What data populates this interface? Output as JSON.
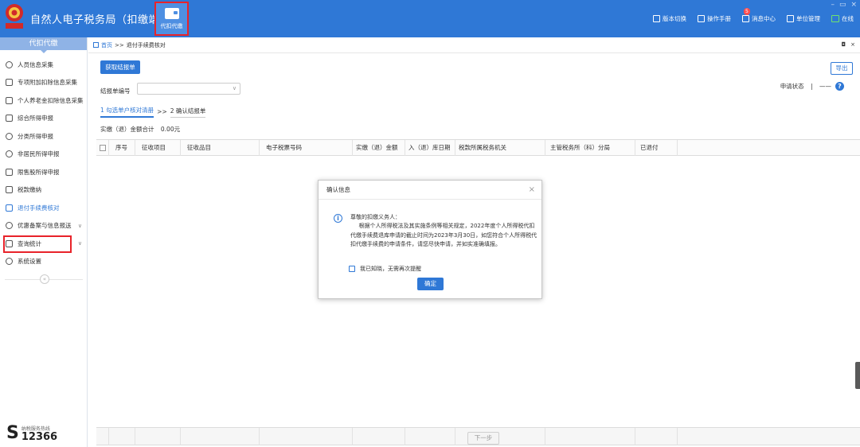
{
  "app": {
    "title": "自然人电子税务局（扣缴端）",
    "module_label": "代扣代缴",
    "window_controls": [
      "–",
      "▭",
      "×"
    ]
  },
  "top_actions": [
    {
      "label": "版本切换",
      "icon": "switch-icon"
    },
    {
      "label": "操作手册",
      "icon": "manual-icon"
    },
    {
      "label": "消息中心",
      "icon": "message-icon",
      "badge": "5"
    },
    {
      "label": "单位管理",
      "icon": "unit-icon"
    },
    {
      "label": "在线",
      "icon": "online-icon"
    }
  ],
  "sidebar": {
    "header": "代扣代缴",
    "items": [
      {
        "label": "人员信息采集",
        "icon": "person-icon"
      },
      {
        "label": "专项附加扣除信息采集",
        "icon": "list-icon"
      },
      {
        "label": "个人养老金扣除信息采集",
        "icon": "document-icon"
      },
      {
        "label": "综合所得申报",
        "icon": "layers-icon"
      },
      {
        "label": "分类所得申报",
        "icon": "pie-icon"
      },
      {
        "label": "非居民所得申报",
        "icon": "foreign-person-icon"
      },
      {
        "label": "限售股所得申报",
        "icon": "bar-chart-icon"
      },
      {
        "label": "税款缴纳",
        "icon": "wallet-icon"
      },
      {
        "label": "退付手续费核对",
        "icon": "refund-icon"
      },
      {
        "label": "优惠备案与信息报送",
        "icon": "report-icon",
        "chevron": "∨"
      },
      {
        "label": "查询统计",
        "icon": "query-icon",
        "chevron": "∨"
      },
      {
        "label": "系统设置",
        "icon": "settings-icon"
      }
    ],
    "active_index": 8,
    "collapse": "«",
    "hotline_label": "纳税服务热线",
    "hotline_number": "12366"
  },
  "breadcrumb": {
    "home": "首页",
    "separator": ">>",
    "current": "退付手续费核对",
    "right": [
      "◘",
      "×"
    ]
  },
  "main": {
    "fetch_button": "获取结报单",
    "export_button": "导出",
    "report_no_label": "结报单编号",
    "report_no_value": "",
    "status_label": "申请状态",
    "status_sep": "|",
    "status_value": "——",
    "help": "?",
    "step1": "1 勾选单户核对清册",
    "step_sep": ">>",
    "step2": "2 确认结报单",
    "total_label": "实缴（退）金额合计",
    "total_value": "0.00元",
    "columns": [
      "序号",
      "征收项目",
      "征收品目",
      "电子税票号码",
      "实缴（退）金额",
      "入（退）库日期",
      "税款所属税务机关",
      "主管税务所（科）分局",
      "已退付"
    ],
    "next_button": "下一步"
  },
  "dialog": {
    "title": "确认信息",
    "close": "×",
    "greeting": "尊敬的扣缴义务人：",
    "body": "根据个人所得税法及其实施条例等相关规定，2022年度个人所得税代扣代缴手续费退库申请的截止时间为2023年3月30日，如您符合个人所得税代扣代缴手续费的申请条件，请您尽快申请，并如实准确填报。",
    "checkbox_label": "我已知晓，无需再次提醒",
    "ok_button": "确定"
  },
  "colors": {
    "brand": "#2f78d6",
    "highlight": "#e8232a",
    "sidebar_header": "#8fb3e6"
  }
}
